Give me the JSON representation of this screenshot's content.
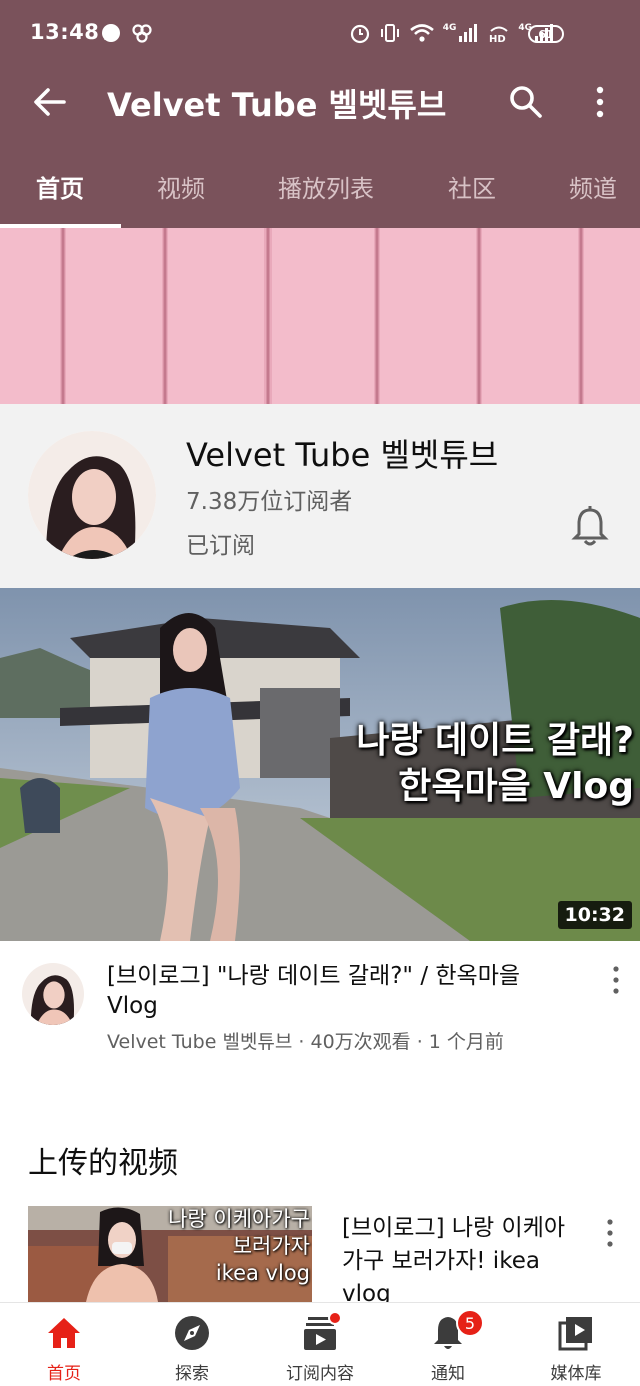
{
  "status_bar": {
    "time": "13:48",
    "network_1": "4G",
    "network_2": "4G",
    "battery": "61"
  },
  "app_bar": {
    "title": "Velvet Tube 벨벳튜브",
    "icons": [
      "arrow-back-icon",
      "search-icon",
      "more-vert-icon"
    ]
  },
  "tabs": [
    {
      "label": "首页",
      "active": true
    },
    {
      "label": "视频",
      "active": false
    },
    {
      "label": "播放列表",
      "active": false
    },
    {
      "label": "社区",
      "active": false
    },
    {
      "label": "频道",
      "active": false
    }
  ],
  "channel": {
    "name": "Velvet Tube 벨벳튜브",
    "subscribers": "7.38万位订阅者",
    "subscribe_status": "已订阅"
  },
  "featured_video": {
    "thumbnail_text_line1": "나랑 데이트 갈래?",
    "thumbnail_text_line2": "한옥마을 Vlog",
    "duration": "10:32",
    "title": "[브이로그] \"나랑 데이트 갈래?\" / 한옥마을 Vlog",
    "meta": "Velvet Tube 벨벳튜브 · 40万次观看 · 1 个月前"
  },
  "uploads": {
    "section_title": "上传的视频",
    "items": [
      {
        "thumbnail_text_line1": "나랑 이케아가구",
        "thumbnail_text_line2": "보러가자",
        "thumbnail_text_line3": "ikea vlog",
        "title": "[브이로그] 나랑 이케아 가구 보러가자! ikea vlog"
      }
    ]
  },
  "bottom_nav": [
    {
      "label": "首页",
      "icon": "home-icon",
      "active": true
    },
    {
      "label": "探索",
      "icon": "explore-icon",
      "active": false
    },
    {
      "label": "订阅内容",
      "icon": "subscriptions-icon",
      "active": false
    },
    {
      "label": "通知",
      "icon": "bell-icon",
      "active": false,
      "badge": "5"
    },
    {
      "label": "媒体库",
      "icon": "library-icon",
      "active": false
    }
  ],
  "colors": {
    "header": "#7a525b",
    "accent_red": "#e62117",
    "banner_pink": "#e8a8ba"
  }
}
